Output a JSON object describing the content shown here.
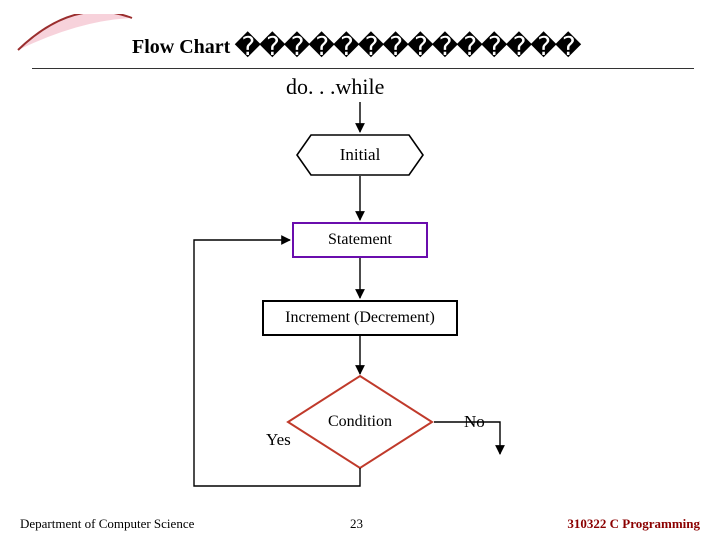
{
  "header": {
    "title_label": "Flow Chart",
    "title_boxes": "��������������",
    "subtitle": "do. . .while"
  },
  "nodes": {
    "initial": "Initial",
    "statement": "Statement",
    "increment": "Increment (Decrement)",
    "condition": "Condition"
  },
  "edges": {
    "yes": "Yes",
    "no": "No"
  },
  "footer": {
    "department": "Department of Computer Science",
    "page": "23",
    "course": "310322 C Programming"
  },
  "colors": {
    "header_accent": "#9a2e2e",
    "statement_border": "#6a0dad",
    "diamond_border": "#c03a2b",
    "course_color": "#8b0000"
  }
}
